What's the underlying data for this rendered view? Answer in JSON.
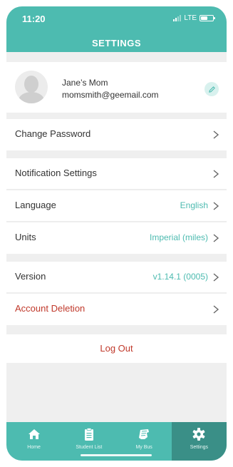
{
  "status_bar": {
    "time": "11:20",
    "network": "LTE"
  },
  "header": {
    "title": "SETTINGS"
  },
  "profile": {
    "name": "Jane’s Mom",
    "email": "momsmith@geemail.com",
    "edit_icon": "pencil-icon"
  },
  "rows": {
    "change_password": {
      "label": "Change Password"
    },
    "notification_settings": {
      "label": "Notification Settings"
    },
    "language": {
      "label": "Language",
      "value": "English"
    },
    "units": {
      "label": "Units",
      "value": "Imperial (miles)"
    },
    "version": {
      "label": "Version",
      "value": "v1.14.1 (0005)"
    },
    "account_deletion": {
      "label": "Account Deletion"
    }
  },
  "logout": {
    "label": "Log Out"
  },
  "tabs": [
    {
      "label": "Home",
      "icon": "home-icon"
    },
    {
      "label": "Student List",
      "icon": "clipboard-icon"
    },
    {
      "label": "My Bus",
      "icon": "bus-icon"
    },
    {
      "label": "Settings",
      "icon": "gear-icon",
      "active": true
    }
  ],
  "colors": {
    "accent": "#4dbbb0",
    "active_tab": "#3a8f87",
    "danger": "#c0392b",
    "background": "#efefef"
  }
}
